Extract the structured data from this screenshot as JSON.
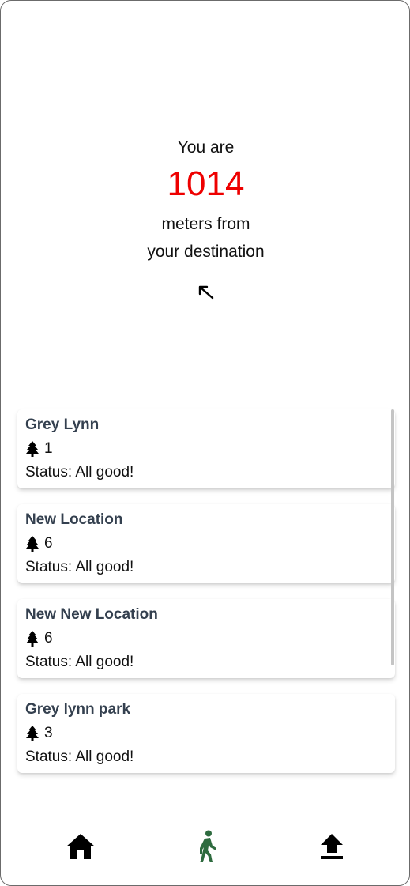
{
  "distance": {
    "prefix": "You are",
    "value": "1014",
    "unit_line1": "meters from",
    "unit_line2": "your destination"
  },
  "locations": [
    {
      "name": "Grey Lynn",
      "count": "1",
      "status": "Status: All good!"
    },
    {
      "name": "New Location",
      "count": "6",
      "status": "Status: All good!"
    },
    {
      "name": "New New Location",
      "count": "6",
      "status": "Status: All good!"
    },
    {
      "name": "Grey lynn park",
      "count": "3",
      "status": "Status: All good!"
    }
  ],
  "nav": {
    "items": [
      {
        "icon": "home-icon",
        "active": false
      },
      {
        "icon": "walk-icon",
        "active": true
      },
      {
        "icon": "upload-icon",
        "active": false
      }
    ],
    "active_color": "#2e6b3f",
    "inactive_color": "#000000"
  },
  "colors": {
    "distance_value": "#ee0000",
    "card_title": "#34404f"
  }
}
